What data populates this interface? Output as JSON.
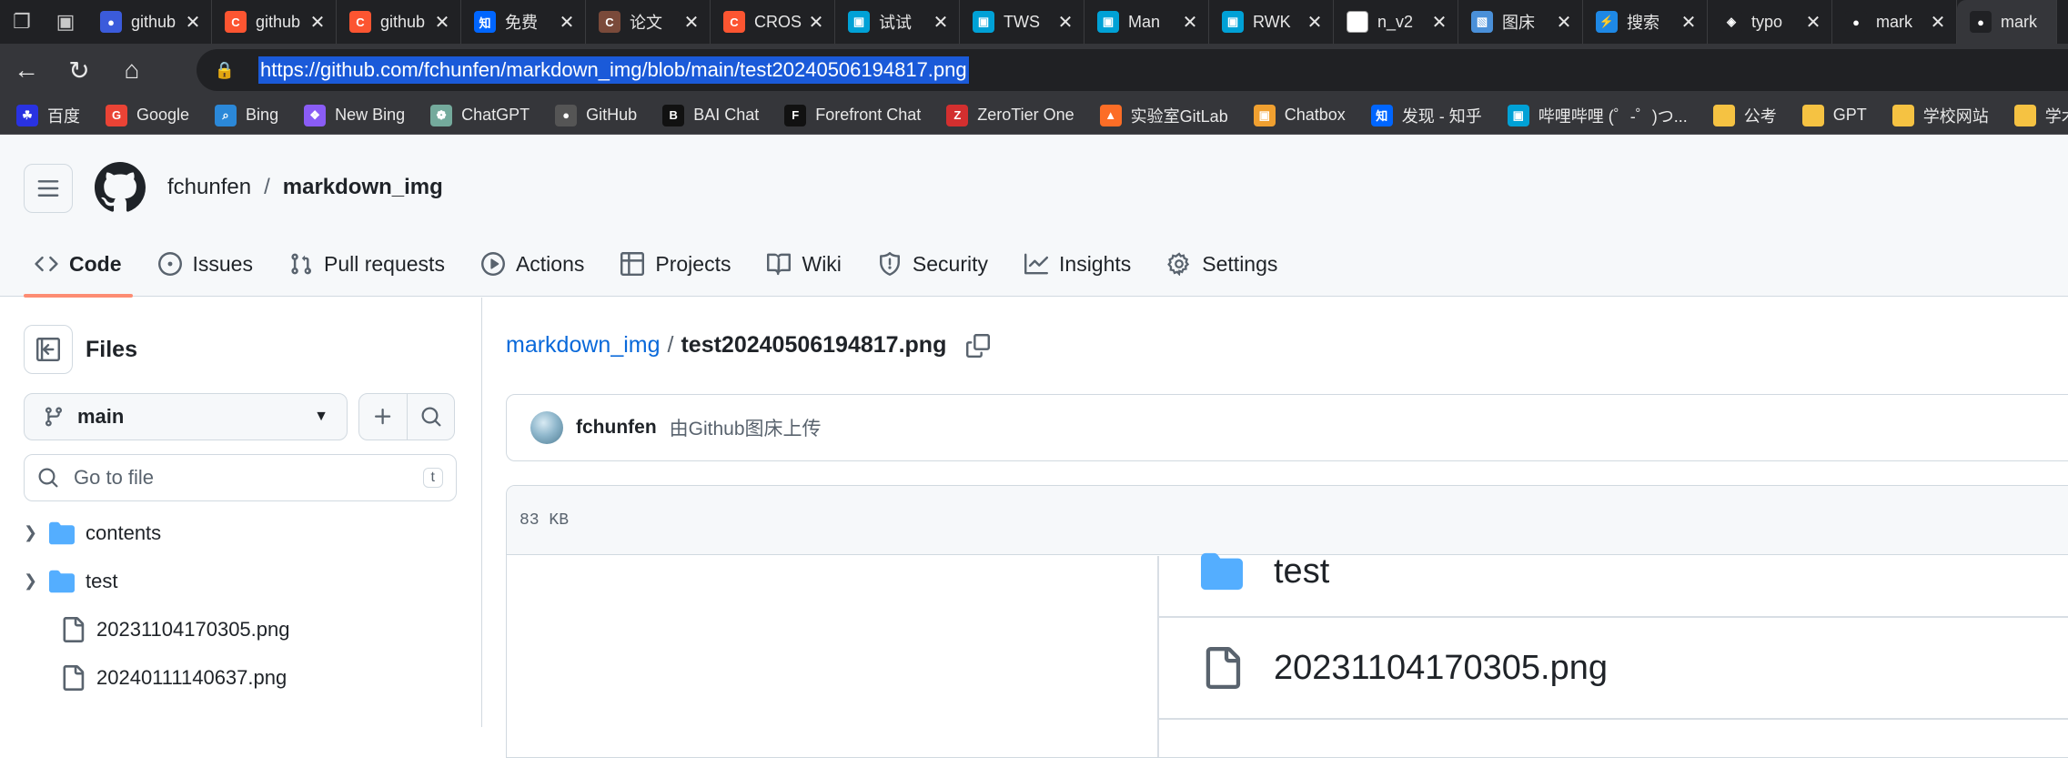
{
  "browser": {
    "tabs": [
      {
        "title": "github",
        "icon": "github-icon",
        "color": "#3b5bdb"
      },
      {
        "title": "github",
        "icon": "csdn-icon",
        "color": "#fc5531"
      },
      {
        "title": "github",
        "icon": "csdn-icon",
        "color": "#fc5531"
      },
      {
        "title": "免费",
        "icon": "zhihu-icon",
        "color": "#0066ff"
      },
      {
        "title": "论文",
        "icon": "csdn-icon",
        "color": "#7a4a3a"
      },
      {
        "title": "CROS",
        "icon": "csdn-icon",
        "color": "#fc5531"
      },
      {
        "title": "试试",
        "icon": "bilibili-icon",
        "color": "#00a1d6"
      },
      {
        "title": "TWS",
        "icon": "bilibili-icon",
        "color": "#00a1d6"
      },
      {
        "title": "Man",
        "icon": "bilibili-icon",
        "color": "#00a1d6"
      },
      {
        "title": "RWK",
        "icon": "bilibili-icon",
        "color": "#00a1d6"
      },
      {
        "title": "n_v2",
        "icon": "blank-page-icon",
        "color": "#ffffff"
      },
      {
        "title": "图床",
        "icon": "image-icon",
        "color": "#4a90d9"
      },
      {
        "title": "搜索",
        "icon": "bolt-icon",
        "color": "#1e88e5"
      },
      {
        "title": "typo",
        "icon": "shield-icon",
        "color": "#202124"
      },
      {
        "title": "mark",
        "icon": "github-icon",
        "color": "#202124"
      },
      {
        "title": "mark",
        "icon": "github-icon",
        "color": "#202124"
      }
    ],
    "url": "https://github.com/fchunfen/markdown_img/blob/main/test20240506194817.png",
    "bookmarks": [
      {
        "label": "百度",
        "icon": "baidu-icon",
        "color": "#2932e1"
      },
      {
        "label": "Google",
        "icon": "google-icon",
        "color": "#ea4335"
      },
      {
        "label": "Bing",
        "icon": "bing-icon",
        "color": "#2b88d8"
      },
      {
        "label": "New Bing",
        "icon": "bing-chat-icon",
        "color": "#8a5cf5"
      },
      {
        "label": "ChatGPT",
        "icon": "openai-icon",
        "color": "#74aa9c"
      },
      {
        "label": "GitHub",
        "icon": "github-icon",
        "color": "#555555"
      },
      {
        "label": "BAI Chat",
        "icon": "bai-icon",
        "color": "#111111"
      },
      {
        "label": "Forefront Chat",
        "icon": "forefront-icon",
        "color": "#111111"
      },
      {
        "label": "ZeroTier One",
        "icon": "zerotier-icon",
        "color": "#d32f2f"
      },
      {
        "label": "实验室GitLab",
        "icon": "gitlab-icon",
        "color": "#fc6d26"
      },
      {
        "label": "Chatbox",
        "icon": "chatbox-icon",
        "color": "#f0a030"
      },
      {
        "label": "发现 - 知乎",
        "icon": "zhihu-icon",
        "color": "#0066ff"
      },
      {
        "label": "哔哩哔哩 (゜-゜)つ...",
        "icon": "bilibili-icon",
        "color": "#00a1d6"
      },
      {
        "label": "公考",
        "icon": "folder-icon",
        "color": "#f5c242"
      },
      {
        "label": "GPT",
        "icon": "folder-icon",
        "color": "#f5c242"
      },
      {
        "label": "学校网站",
        "icon": "folder-icon",
        "color": "#f5c242"
      },
      {
        "label": "学术",
        "icon": "folder-icon",
        "color": "#f5c242"
      }
    ]
  },
  "repo": {
    "owner": "fchunfen",
    "separator": "/",
    "name": "markdown_img"
  },
  "nav_tabs": [
    {
      "label": "Code",
      "icon": "code-icon",
      "active": true
    },
    {
      "label": "Issues",
      "icon": "issue-icon"
    },
    {
      "label": "Pull requests",
      "icon": "pull-request-icon"
    },
    {
      "label": "Actions",
      "icon": "play-icon"
    },
    {
      "label": "Projects",
      "icon": "table-icon"
    },
    {
      "label": "Wiki",
      "icon": "book-icon"
    },
    {
      "label": "Security",
      "icon": "shield-icon"
    },
    {
      "label": "Insights",
      "icon": "graph-icon"
    },
    {
      "label": "Settings",
      "icon": "gear-icon"
    }
  ],
  "sidebar": {
    "title": "Files",
    "branch": "main",
    "goto_placeholder": "Go to file",
    "goto_shortcut": "t",
    "tree": [
      {
        "name": "contents",
        "type": "folder"
      },
      {
        "name": "test",
        "type": "folder"
      },
      {
        "name": "20231104170305.png",
        "type": "file"
      },
      {
        "name": "20240111140637.png",
        "type": "file"
      }
    ]
  },
  "file": {
    "repo_link": "markdown_img",
    "path_sep": "/",
    "name": "test20240506194817.png",
    "commit_author": "fchunfen",
    "commit_message": "由Github图床上传",
    "size": "83 KB"
  },
  "preview": {
    "rows": [
      {
        "name": "test",
        "type": "folder"
      },
      {
        "name": "20231104170305.png",
        "type": "file"
      }
    ]
  },
  "colors": {
    "accent_link": "#0969da",
    "tab_underline": "#fd8c73",
    "folder": "#54aeff",
    "url_highlight": "#1a5ad9"
  }
}
